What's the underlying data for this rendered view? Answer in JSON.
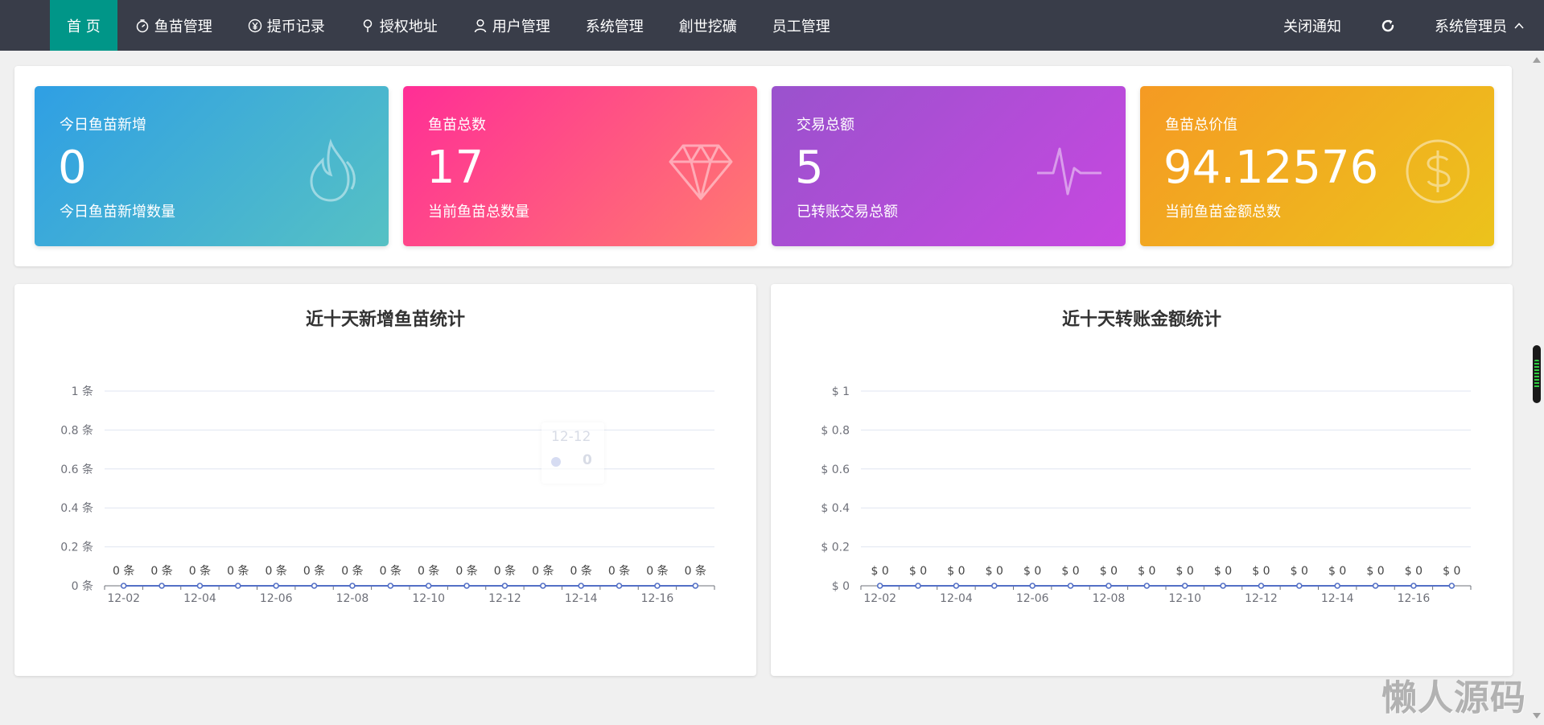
{
  "nav": {
    "items": [
      {
        "label": "首 页",
        "icon": "none"
      },
      {
        "label": "鱼苗管理",
        "icon": "timer-icon"
      },
      {
        "label": "提币记录",
        "icon": "yen-icon"
      },
      {
        "label": "授权地址",
        "icon": "location-pin-icon"
      },
      {
        "label": "用户管理",
        "icon": "user-icon"
      },
      {
        "label": "系统管理",
        "icon": "none"
      },
      {
        "label": "創世挖礦",
        "icon": "none"
      },
      {
        "label": "员工管理",
        "icon": "none"
      }
    ],
    "close_notice": "关闭通知",
    "admin": "系统管理员"
  },
  "stats": [
    {
      "title": "今日鱼苗新增",
      "value": "0",
      "sub": "今日鱼苗新增数量",
      "icon": "flame-icon"
    },
    {
      "title": "鱼苗总数",
      "value": "17",
      "sub": "当前鱼苗总数量",
      "icon": "diamond-icon"
    },
    {
      "title": "交易总额",
      "value": "5",
      "sub": "已转账交易总额",
      "icon": "pulse-icon"
    },
    {
      "title": "鱼苗总价值",
      "value": "94.12576",
      "sub": "当前鱼苗金额总数",
      "icon": "dollar-circle-icon"
    }
  ],
  "colors": {
    "nav_bg": "#393d49",
    "nav_active": "#009688",
    "line": "#5470c6",
    "grid": "#e0e6f1"
  },
  "chart_data": [
    {
      "type": "line",
      "title": "近十天新增鱼苗统计",
      "x": [
        "12-02",
        "12-03",
        "12-04",
        "12-05",
        "12-06",
        "12-07",
        "12-08",
        "12-09",
        "12-10",
        "12-11",
        "12-12",
        "12-13",
        "12-14",
        "12-15",
        "12-16",
        "12-17"
      ],
      "x_tick_labels": [
        "12-02",
        "12-04",
        "12-06",
        "12-08",
        "12-10",
        "12-12",
        "12-14",
        "12-16"
      ],
      "values": [
        0,
        0,
        0,
        0,
        0,
        0,
        0,
        0,
        0,
        0,
        0,
        0,
        0,
        0,
        0,
        0
      ],
      "ylim": [
        0,
        1
      ],
      "y_ticks": [
        0,
        0.2,
        0.4,
        0.6,
        0.8,
        1
      ],
      "y_prefix": "",
      "y_suffix": " 条",
      "label_prefix": "",
      "label_suffix": " 条",
      "grid": true,
      "tooltip": {
        "date": "12-12",
        "value": "0"
      }
    },
    {
      "type": "line",
      "title": "近十天转账金额统计",
      "x": [
        "12-02",
        "12-03",
        "12-04",
        "12-05",
        "12-06",
        "12-07",
        "12-08",
        "12-09",
        "12-10",
        "12-11",
        "12-12",
        "12-13",
        "12-14",
        "12-15",
        "12-16",
        "12-17"
      ],
      "x_tick_labels": [
        "12-02",
        "12-04",
        "12-06",
        "12-08",
        "12-10",
        "12-12",
        "12-14",
        "12-16"
      ],
      "values": [
        0,
        0,
        0,
        0,
        0,
        0,
        0,
        0,
        0,
        0,
        0,
        0,
        0,
        0,
        0,
        0
      ],
      "ylim": [
        0,
        1
      ],
      "y_ticks": [
        0,
        0.2,
        0.4,
        0.6,
        0.8,
        1
      ],
      "y_prefix": "$ ",
      "y_suffix": "",
      "label_prefix": "$ ",
      "label_suffix": "",
      "grid": true
    }
  ],
  "watermark": "懒人源码"
}
